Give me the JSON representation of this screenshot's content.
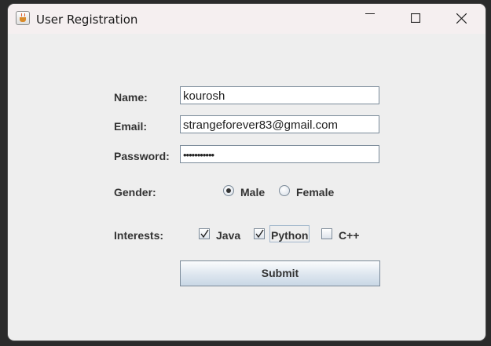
{
  "window": {
    "title": "User Registration",
    "icon": "java-cup-icon",
    "controls": [
      "minimize",
      "maximize",
      "close"
    ]
  },
  "form": {
    "name": {
      "label": "Name:",
      "value": "kourosh"
    },
    "email": {
      "label": "Email:",
      "value": "strangeforever83@gmail.com"
    },
    "password": {
      "label": "Password:",
      "value": "•••••••••••"
    },
    "gender": {
      "label": "Gender:",
      "options": [
        {
          "label": "Male",
          "selected": true
        },
        {
          "label": "Female",
          "selected": false
        }
      ]
    },
    "interests": {
      "label": "Interests:",
      "options": [
        {
          "label": "Java",
          "checked": true
        },
        {
          "label": "Python",
          "checked": true,
          "focused": true
        },
        {
          "label": "C++",
          "checked": false
        }
      ]
    },
    "submit_label": "Submit"
  }
}
